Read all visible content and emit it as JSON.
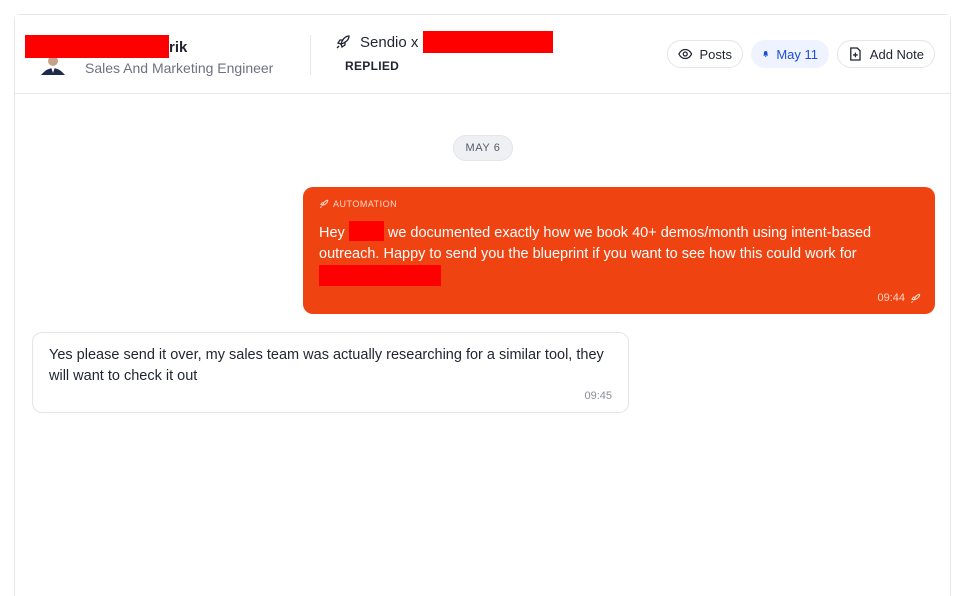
{
  "header": {
    "contact_name_suffix": "rik",
    "contact_role": "Sales And Marketing Engineer",
    "campaign_prefix": "Sendio x",
    "campaign_status": "REPLIED",
    "posts_label": "Posts",
    "date_label": "May 11",
    "add_note_label": "Add Note"
  },
  "conversation": {
    "date_divider": "MAY 6",
    "outgoing": {
      "tag": "AUTOMATION",
      "greeting": "Hey",
      "text": " we documented exactly how we book 40+ demos/month using intent-based outreach.  Happy to send you the blueprint if you want to see how this could work for ",
      "time": "09:44"
    },
    "incoming": {
      "text": "Yes please send it over, my sales team was actually researching for a similar tool, they will want to check it out",
      "time": "09:45"
    }
  },
  "colors": {
    "accent_orange": "#f04312",
    "redaction": "#ff0000",
    "date_pill_text": "#1d4ed8"
  }
}
